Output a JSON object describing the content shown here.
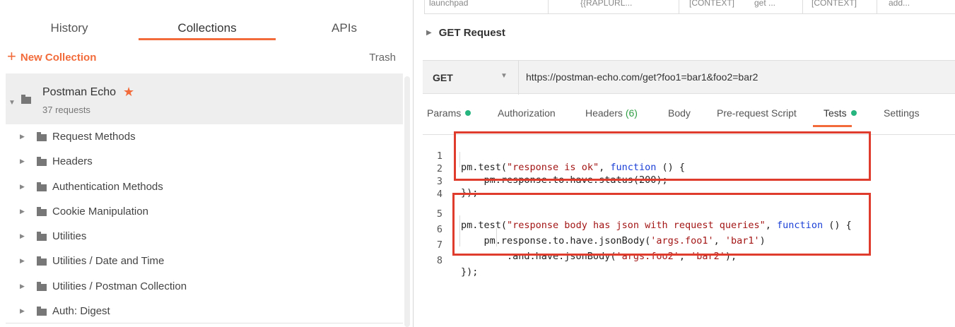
{
  "sidebar": {
    "tabs": [
      "History",
      "Collections",
      "APIs"
    ],
    "new_collection": "New Collection",
    "trash": "Trash",
    "collection": {
      "name": "Postman Echo",
      "count": "37 requests"
    },
    "folders": [
      "Request Methods",
      "Headers",
      "Authentication Methods",
      "Cookie Manipulation",
      "Utilities",
      "Utilities / Date and Time",
      "Utilities / Postman Collection",
      "Auth: Digest"
    ]
  },
  "main": {
    "top_table_cells": [
      "launchpad",
      "{{RAPLURL...",
      "[CONTEXT]",
      "get ...",
      "[CONTEXT]",
      "add..."
    ],
    "request_title": "GET Request",
    "method": "GET",
    "url": "https://postman-echo.com/get?foo1=bar1&foo2=bar2",
    "tabs": {
      "params": "Params",
      "authorization": "Authorization",
      "headers": "Headers",
      "headers_count": "(6)",
      "body": "Body",
      "prerequest": "Pre-request Script",
      "tests": "Tests",
      "settings": "Settings"
    },
    "code": {
      "line_numbers": [
        "1",
        "2",
        "3",
        "4",
        "5",
        "6",
        "7",
        "8"
      ],
      "l1_a": "pm.test(",
      "l1_str": "\"response is ok\"",
      "l1_b": ", ",
      "l1_kw": "function",
      "l1_c": " () {",
      "l2": "    pm.response.to.have.status(200);",
      "l3": "});",
      "l5_a": "pm.test(",
      "l5_str": "\"response body has json with request queries\"",
      "l5_b": ", ",
      "l5_kw": "function",
      "l5_c": " () {",
      "l6_a": "    pm.response.to.have.jsonBody(",
      "l6_s1": "'args.foo1'",
      "l6_b": ", ",
      "l6_s2": "'bar1'",
      "l6_c": ")",
      "l7_a": "        .and.have.jsonBody(",
      "l7_s1": "'args.foo2'",
      "l7_b": ", ",
      "l7_s2": "'bar2'",
      "l7_c": ");",
      "l8": "});"
    }
  },
  "colors": {
    "accent": "#f26b3a",
    "success_dot": "#26b47f",
    "highlight_box": "#e03c2e",
    "string": "#a31515",
    "keyword": "#1a3fd6"
  }
}
